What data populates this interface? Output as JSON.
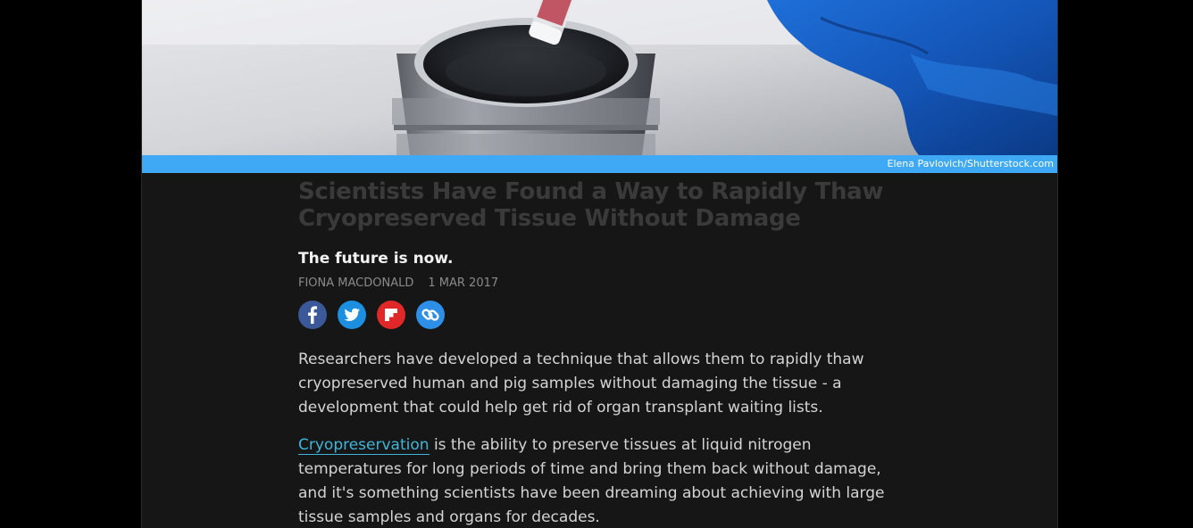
{
  "hero": {
    "image_alt": "Gloved hand lowering a vial into a liquid nitrogen container",
    "credit": "Elena Pavlovich/Shutterstock.com"
  },
  "article": {
    "title": "Scientists Have Found a Way to Rapidly Thaw Cryopreserved Tissue Without Damage",
    "subtitle": "The future is now.",
    "author": "FIONA MACDONALD",
    "date": "1 MAR 2017",
    "share": [
      {
        "name": "facebook",
        "icon": "facebook-icon",
        "color": "#3b5998"
      },
      {
        "name": "twitter",
        "icon": "twitter-icon",
        "color": "#1da1f2"
      },
      {
        "name": "flipboard",
        "icon": "flipboard-icon",
        "color": "#e12828"
      },
      {
        "name": "copy-link",
        "icon": "link-icon",
        "color": "#2e8fe8"
      }
    ],
    "paragraph1": "Researchers have developed a technique that allows them to rapidly thaw cryopreserved human and pig samples without damaging the tissue - a development that could help get rid of organ transplant waiting lists.",
    "paragraph2_link": "Cryopreservation",
    "paragraph2_rest": " is the ability to preserve tissues at liquid nitrogen temperatures for long periods of time and bring them back without damage, and it's something scientists have been dreaming about achieving with large tissue samples and organs for decades."
  },
  "colors": {
    "accent": "#3fa9f5",
    "link": "#3fb6d9",
    "background": "#161616"
  }
}
